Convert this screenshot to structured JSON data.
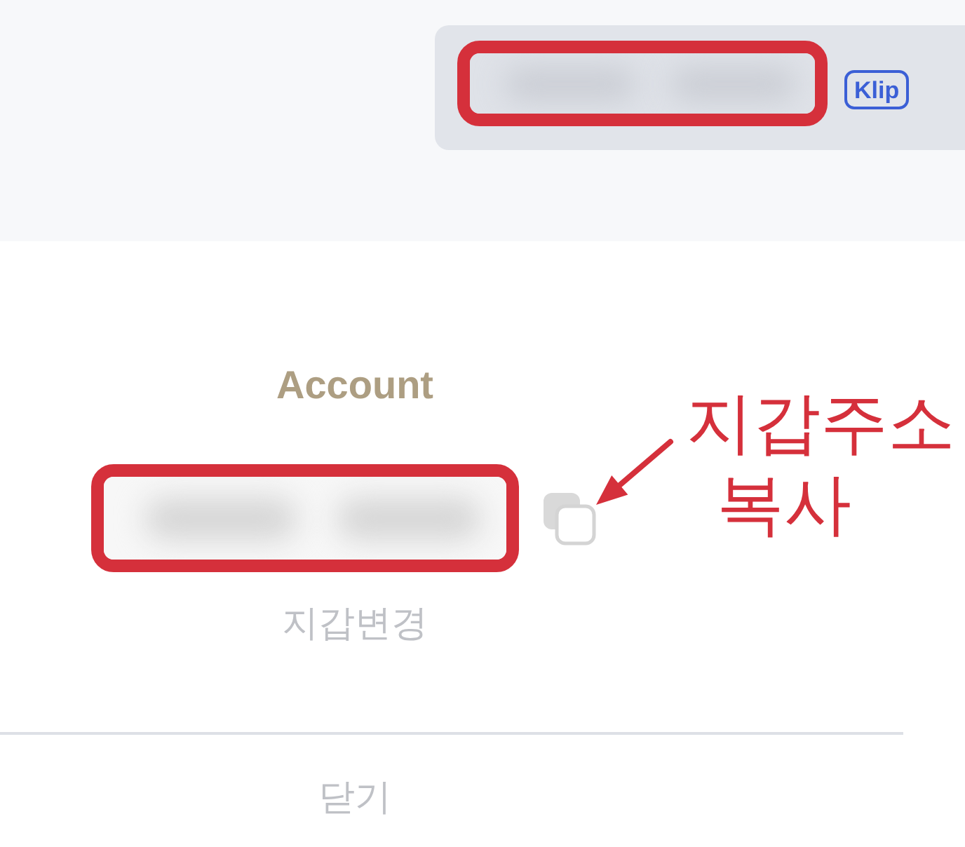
{
  "wallet_pill": {
    "address_highlighted": true,
    "logo": "Klip"
  },
  "account": {
    "title": "Account",
    "address_highlighted": true,
    "copy_callout": [
      "지갑주소",
      "복사"
    ],
    "change_wallet": "지갑변경"
  },
  "close_button": "닫기"
}
